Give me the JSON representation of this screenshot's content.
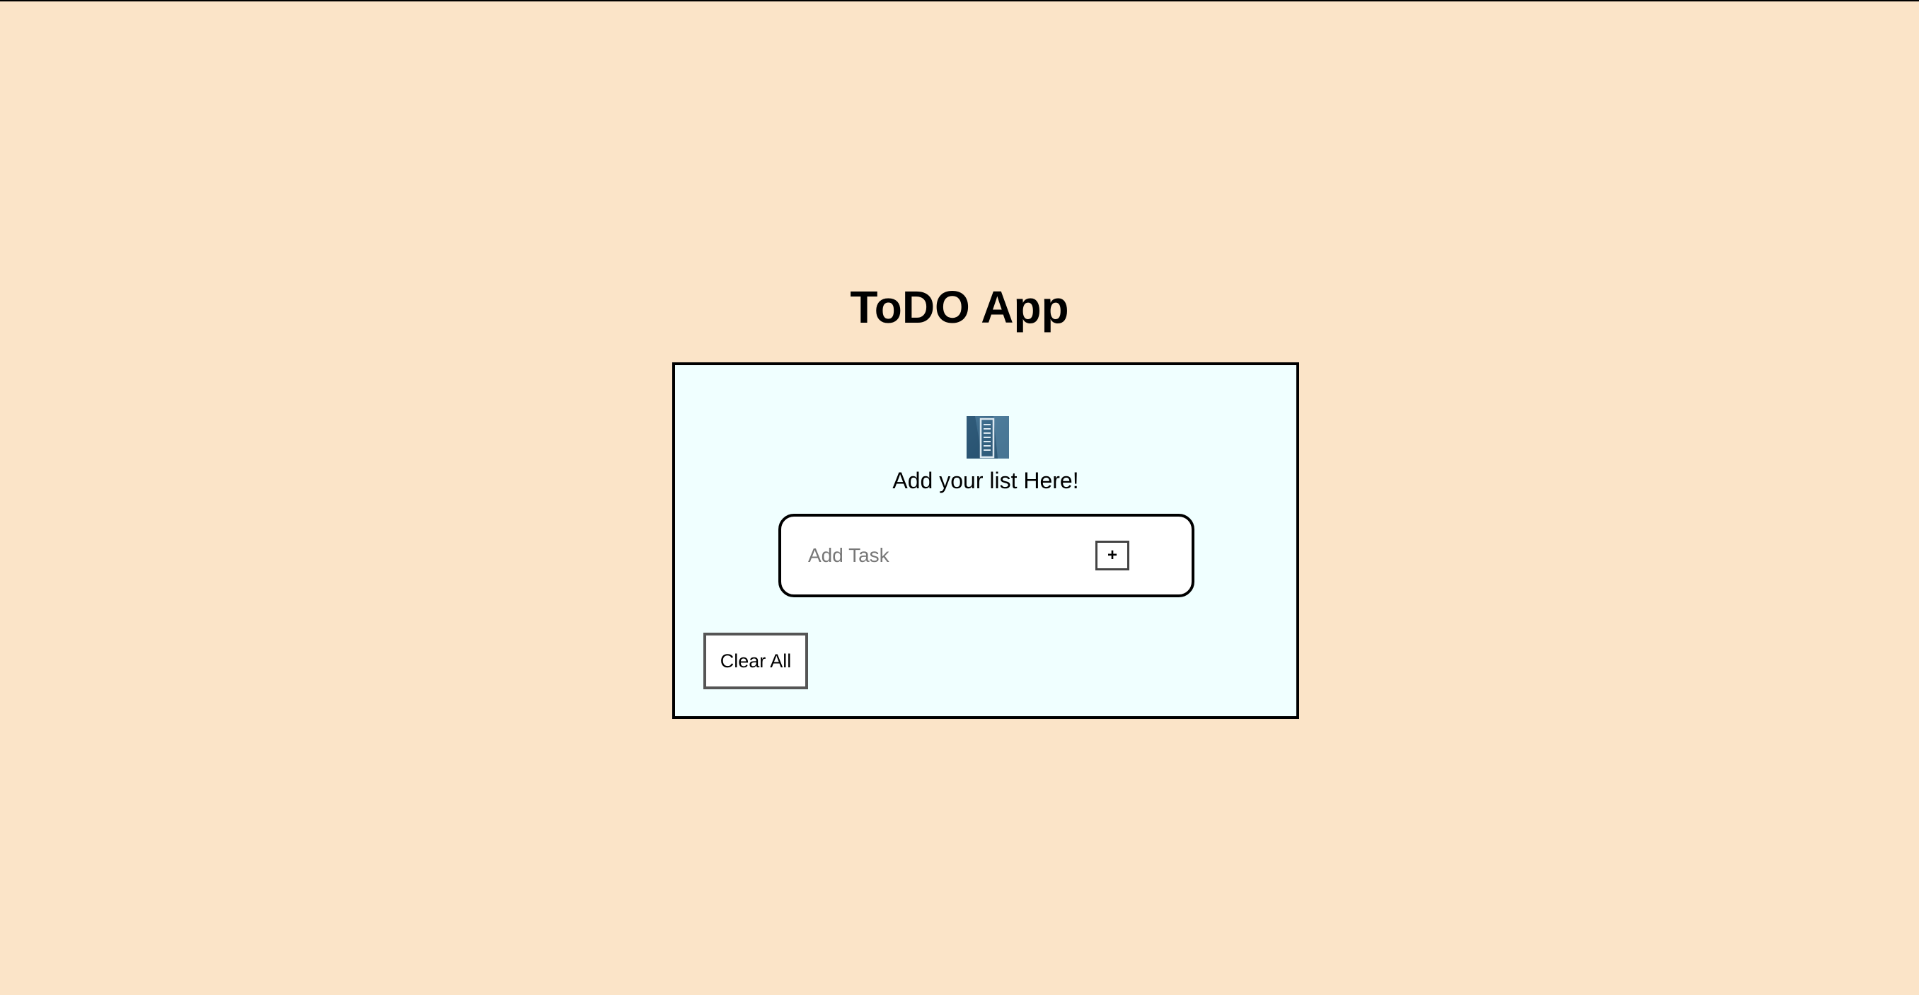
{
  "header": {
    "title": "ToDO App"
  },
  "card": {
    "icon": "list-icon",
    "subtitle": "Add your list Here!",
    "task_input": {
      "value": "",
      "placeholder": "Add Task"
    },
    "add_label": "+",
    "clear_label": "Clear All"
  },
  "colors": {
    "page_background": "#fbe4c8",
    "card_background": "#f0ffff",
    "border": "#000000"
  }
}
